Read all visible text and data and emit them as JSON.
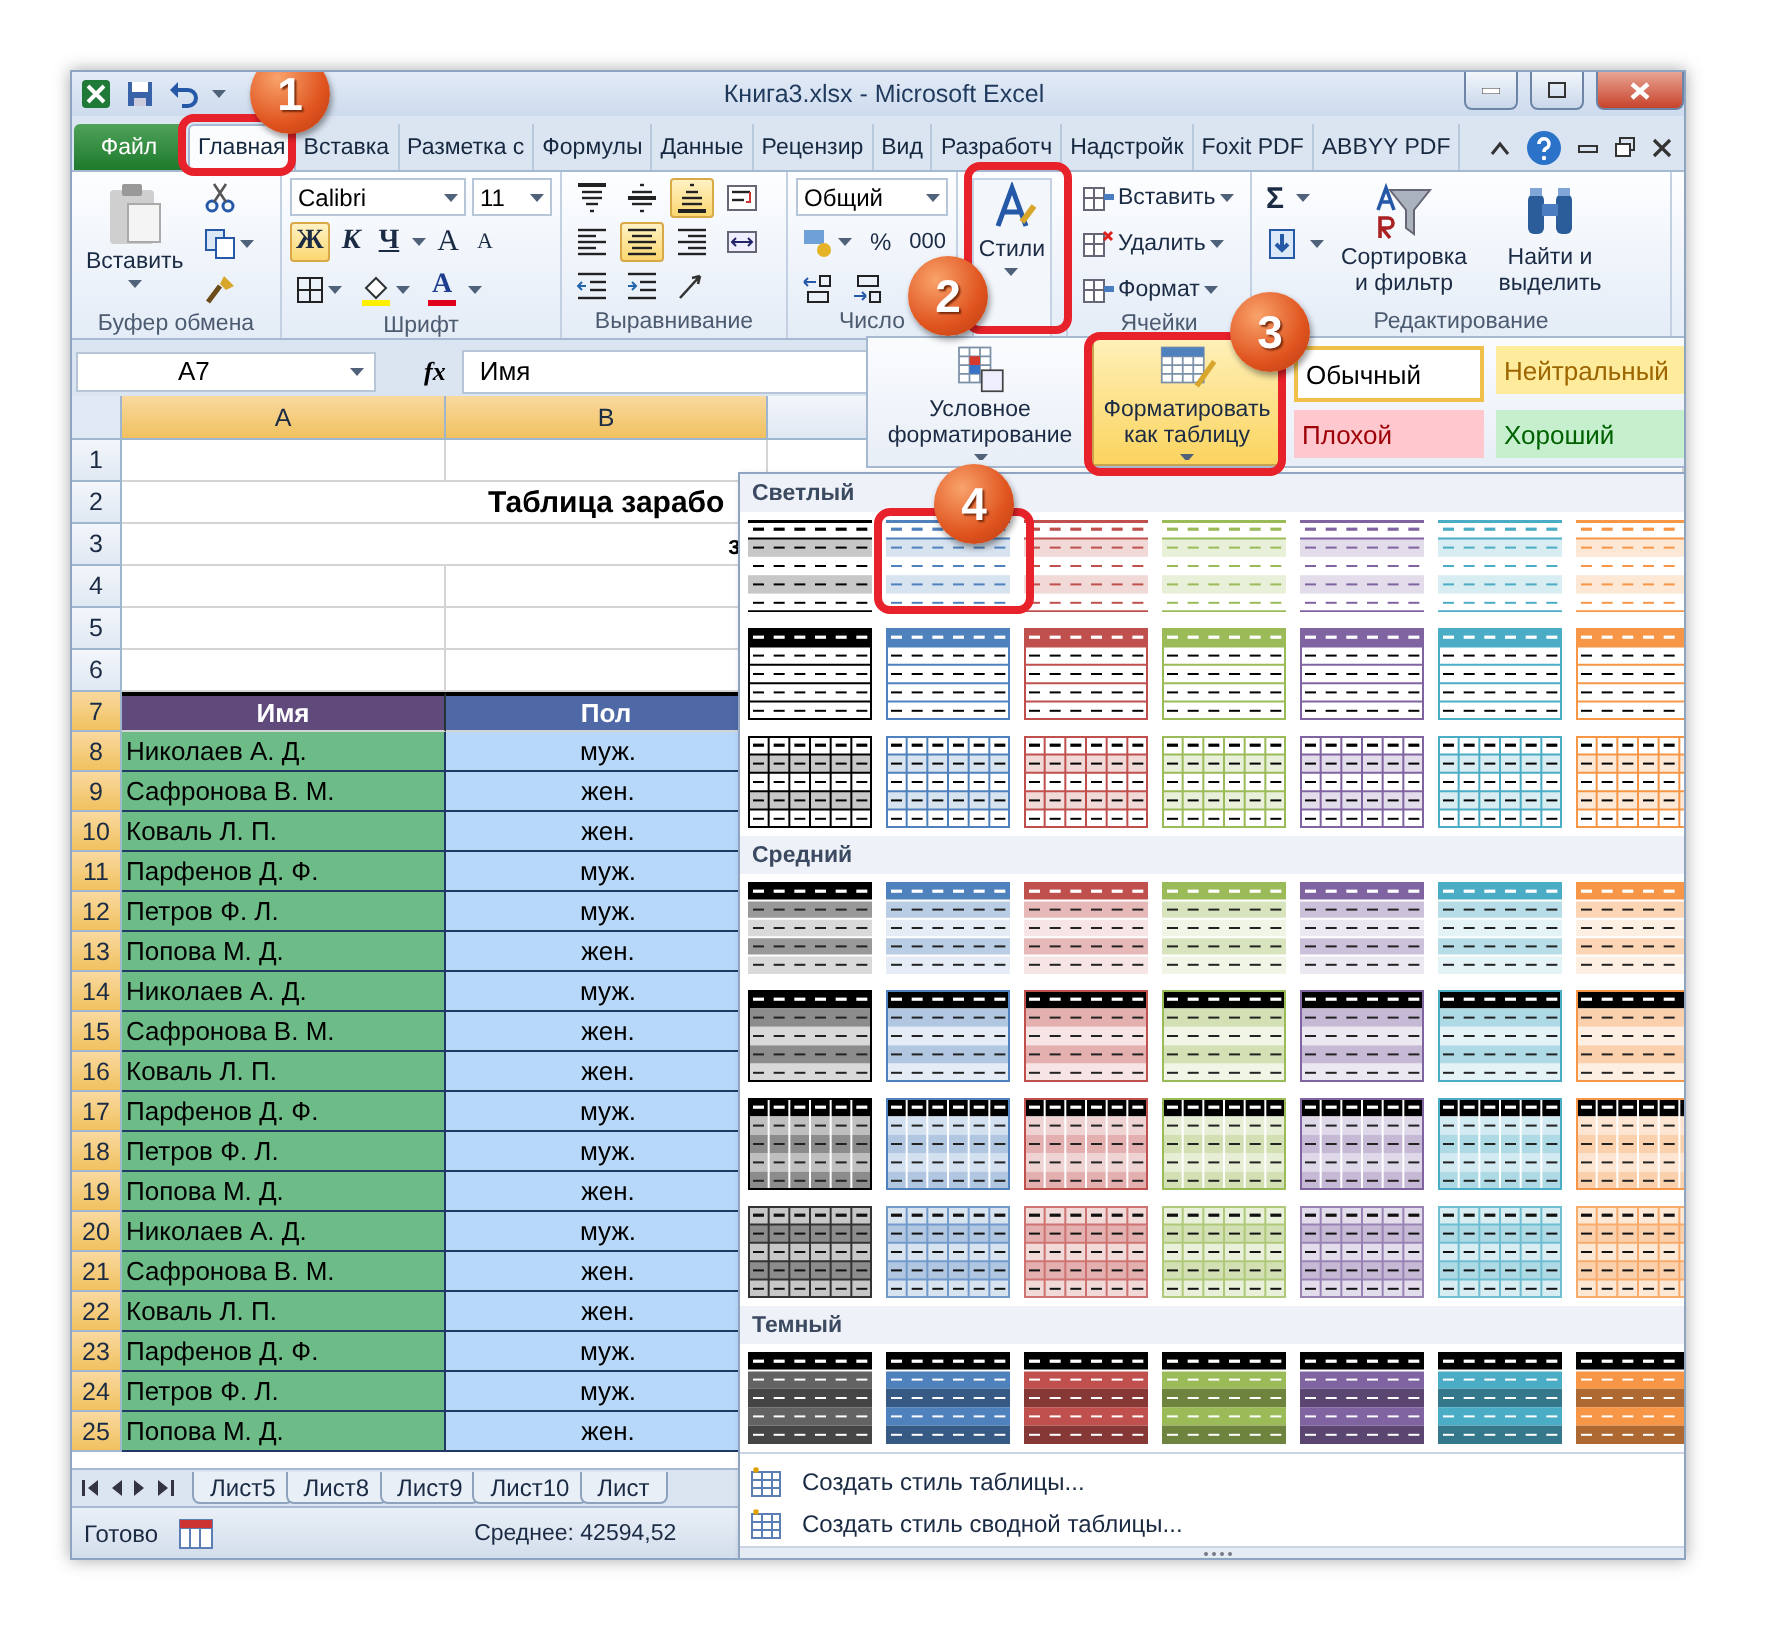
{
  "window": {
    "title": "Книга3.xlsx - Microsoft Excel"
  },
  "ribbon_tabs": [
    {
      "label": "Файл",
      "kind": "file",
      "selected": false
    },
    {
      "label": "Главная",
      "kind": "tab",
      "selected": true
    },
    {
      "label": "Вставка",
      "kind": "tab",
      "selected": false
    },
    {
      "label": "Разметка с",
      "kind": "tab",
      "selected": false
    },
    {
      "label": "Формулы",
      "kind": "tab",
      "selected": false
    },
    {
      "label": "Данные",
      "kind": "tab",
      "selected": false
    },
    {
      "label": "Рецензир",
      "kind": "tab",
      "selected": false
    },
    {
      "label": "Вид",
      "kind": "tab",
      "selected": false
    },
    {
      "label": "Разработч",
      "kind": "tab",
      "selected": false
    },
    {
      "label": "Надстройк",
      "kind": "tab",
      "selected": false
    },
    {
      "label": "Foxit PDF",
      "kind": "tab",
      "selected": false
    },
    {
      "label": "ABBYY PDF",
      "kind": "tab",
      "selected": false
    }
  ],
  "ribbon": {
    "clipboard": {
      "paste": "Вставить",
      "label": "Буфер обмена"
    },
    "font": {
      "name": "Calibri",
      "size": "11",
      "bold": {
        "text": "Ж",
        "on": true
      },
      "italic": "К",
      "underline": "Ч",
      "grow": "A",
      "shrink": "A",
      "color_letter": "A",
      "label": "Шрифт"
    },
    "alignment": {
      "label": "Выравнивание",
      "buttons": [
        {
          "kind": "top",
          "on": false
        },
        {
          "kind": "middle",
          "on": false
        },
        {
          "kind": "bottom",
          "on": true
        },
        {
          "kind": "wrap",
          "on": false
        },
        {
          "kind": "left",
          "on": false
        },
        {
          "kind": "center",
          "on": true
        },
        {
          "kind": "right",
          "on": false
        },
        {
          "kind": "merge",
          "on": false
        },
        {
          "kind": "outdent",
          "on": false
        },
        {
          "kind": "indent",
          "on": false
        },
        {
          "kind": "orientation",
          "on": false
        }
      ]
    },
    "number": {
      "format": "Общий",
      "percent": "%",
      "thousands": "000",
      "label": "Число"
    },
    "styles": {
      "label": "Стили"
    },
    "cells": {
      "items": [
        "Вставить",
        "Удалить",
        "Формат"
      ],
      "label": "Ячейки"
    },
    "editing": {
      "sigma": "Σ",
      "sort": "Сортировка и фильтр",
      "find": "Найти и выделить",
      "label": "Редактирование"
    }
  },
  "formula_bar": {
    "name_box": "A7",
    "fx": "fx",
    "value": "Имя"
  },
  "sheet": {
    "columns": [
      {
        "label": "A",
        "selected": true
      },
      {
        "label": "B",
        "selected": true
      }
    ],
    "rows": [
      {
        "header": "1",
        "kind": "blank",
        "selected": false
      },
      {
        "header": "2",
        "kind": "title",
        "selected": false,
        "text": "Таблица зарабо"
      },
      {
        "header": "3",
        "kind": "subtitle",
        "selected": false,
        "text": "з"
      },
      {
        "header": "4",
        "kind": "blank",
        "selected": false
      },
      {
        "header": "5",
        "kind": "blank",
        "selected": false
      },
      {
        "header": "6",
        "kind": "blank",
        "selected": false
      },
      {
        "header": "7",
        "kind": "header",
        "selected": true,
        "cells": [
          "Имя",
          "Пол"
        ]
      },
      {
        "header": "8",
        "kind": "data",
        "selected": true,
        "cells": [
          "Николаев А. Д.",
          "муж."
        ]
      },
      {
        "header": "9",
        "kind": "data",
        "selected": true,
        "cells": [
          "Сафронова В. М.",
          "жен."
        ]
      },
      {
        "header": "10",
        "kind": "data",
        "selected": true,
        "cells": [
          "Коваль Л. П.",
          "жен."
        ]
      },
      {
        "header": "11",
        "kind": "data",
        "selected": true,
        "cells": [
          "Парфенов Д. Ф.",
          "муж."
        ]
      },
      {
        "header": "12",
        "kind": "data",
        "selected": true,
        "cells": [
          "Петров Ф. Л.",
          "муж."
        ]
      },
      {
        "header": "13",
        "kind": "data",
        "selected": true,
        "cells": [
          "Попова М. Д.",
          "жен."
        ]
      },
      {
        "header": "14",
        "kind": "data",
        "selected": true,
        "cells": [
          "Николаев А. Д.",
          "муж."
        ]
      },
      {
        "header": "15",
        "kind": "data",
        "selected": true,
        "cells": [
          "Сафронова В. М.",
          "жен."
        ]
      },
      {
        "header": "16",
        "kind": "data",
        "selected": true,
        "cells": [
          "Коваль Л. П.",
          "жен."
        ]
      },
      {
        "header": "17",
        "kind": "data",
        "selected": true,
        "cells": [
          "Парфенов Д. Ф.",
          "муж."
        ]
      },
      {
        "header": "18",
        "kind": "data",
        "selected": true,
        "cells": [
          "Петров Ф. Л.",
          "муж."
        ]
      },
      {
        "header": "19",
        "kind": "data",
        "selected": true,
        "cells": [
          "Попова М. Д.",
          "жен."
        ]
      },
      {
        "header": "20",
        "kind": "data",
        "selected": true,
        "cells": [
          "Николаев А. Д.",
          "муж."
        ]
      },
      {
        "header": "21",
        "kind": "data",
        "selected": true,
        "cells": [
          "Сафронова В. М.",
          "жен."
        ]
      },
      {
        "header": "22",
        "kind": "data",
        "selected": true,
        "cells": [
          "Коваль Л. П.",
          "жен."
        ]
      },
      {
        "header": "23",
        "kind": "data",
        "selected": true,
        "cells": [
          "Парфенов Д. Ф.",
          "муж."
        ]
      },
      {
        "header": "24",
        "kind": "data",
        "selected": true,
        "cells": [
          "Петров Ф. Л.",
          "муж."
        ]
      },
      {
        "header": "25",
        "kind": "data",
        "selected": true,
        "cells": [
          "Попова М. Д.",
          "жен."
        ]
      }
    ]
  },
  "sheet_tabs": [
    "Лист5",
    "Лист8",
    "Лист9",
    "Лист10",
    "Лист"
  ],
  "status_bar": {
    "mode": "Готово",
    "summary": "Среднее: 42594,52"
  },
  "styles_menu": {
    "conditional": "Условное форматирование",
    "format_table": "Форматировать как таблицу",
    "cell_styles": [
      {
        "label": "Обычный",
        "kind": "normal"
      },
      {
        "label": "Нейтральный",
        "kind": "neutral"
      },
      {
        "label": "Плохой",
        "kind": "bad"
      },
      {
        "label": "Хороший",
        "kind": "good"
      }
    ]
  },
  "table_gallery": {
    "columns": [
      {
        "color": "#000000"
      },
      {
        "color": "#4f81bd"
      },
      {
        "color": "#c0504d"
      },
      {
        "color": "#9bbb59"
      },
      {
        "color": "#8064a2"
      },
      {
        "color": "#4bacc6"
      },
      {
        "color": "#f79646"
      }
    ],
    "sections": [
      {
        "title": "Светлый",
        "rows": [
          {
            "kind": "light-banded"
          },
          {
            "kind": "light-header"
          },
          {
            "kind": "light-grid"
          }
        ]
      },
      {
        "title": "Средний",
        "rows": [
          {
            "kind": "medium-banded"
          },
          {
            "kind": "medium-dark-header"
          },
          {
            "kind": "medium-grid-header"
          },
          {
            "kind": "medium-grid"
          }
        ]
      },
      {
        "title": "Темный",
        "rows": [
          {
            "kind": "dark"
          }
        ]
      }
    ],
    "commands": [
      "Создать стиль таблицы...",
      "Создать стиль сводной таблицы..."
    ]
  },
  "callouts": [
    "1",
    "2",
    "3",
    "4"
  ]
}
